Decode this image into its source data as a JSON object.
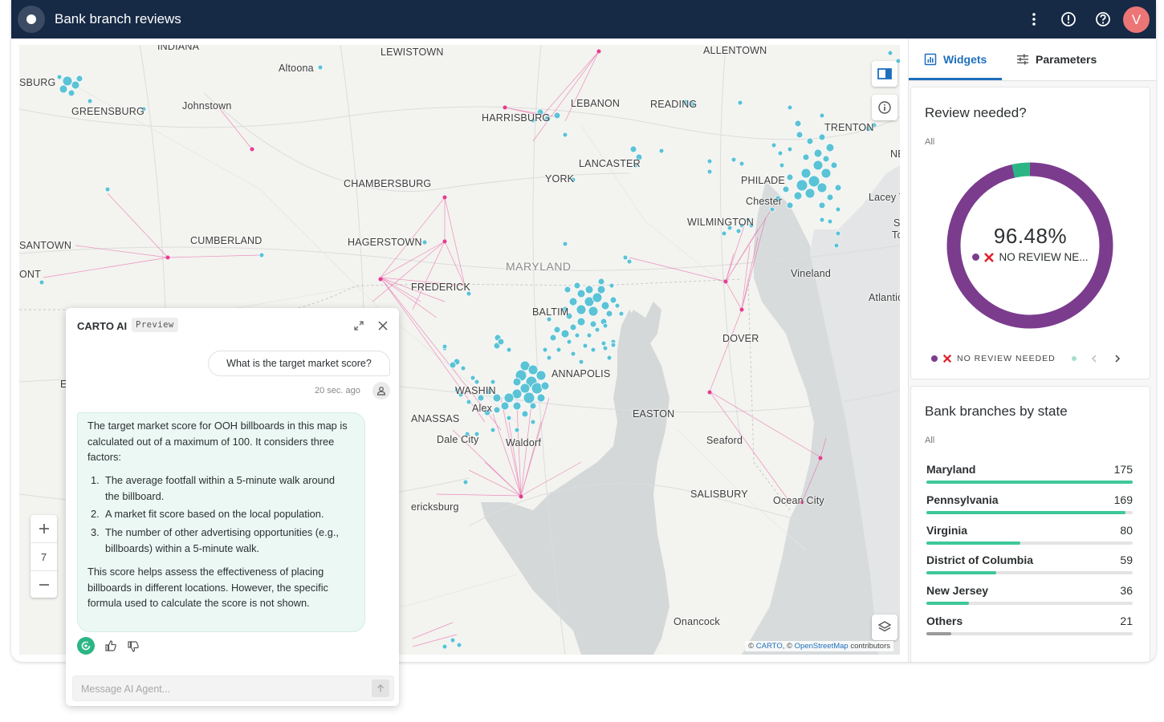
{
  "app": {
    "title": "Bank branch reviews",
    "avatar_letter": "V",
    "colors": {
      "topbar": "#162945",
      "accent": "#1f6fbd",
      "avatar": "#ec7575",
      "bar": "#3ec79a",
      "donut": "#7b3c8e",
      "donut_minor": "#2bb585"
    }
  },
  "map": {
    "labels": {
      "indiana": "INDIANA",
      "lewistown": "LEWISTOWN",
      "allentown": "ALLENTOWN",
      "altoona": "Altoona",
      "burg": "SBURG",
      "greensburg": "GREENSBURG",
      "johnstown": "Johnstown",
      "lebanon": "LEBANON",
      "reading": "READING",
      "harrisburg": "HARRISBURG",
      "trenton": "TRENTON",
      "new": "NEW",
      "lancaster": "LANCASTER",
      "york": "YORK",
      "chambersburg": "CHAMBERSBURG",
      "philadelphia": "PHILADE",
      "chester": "Chester",
      "lacey": "Lacey To",
      "s": "S",
      "to": "To",
      "wilmington": "WILMINGTON",
      "santown": "SANTOWN",
      "cumberland": "CUMBERLAND",
      "hagerstown": "HAGERSTOWN",
      "maryland": "MARYLAND",
      "ont": "ONT",
      "frederick": "FREDERICK",
      "vineland": "Vineland",
      "baltimore": "BALTIM",
      "atlantic": "Atlantic C",
      "dover": "DOVER",
      "elk": "ELK",
      "annapolis": "ANNAPOLIS",
      "washington": "WASHIN",
      "alexandria": "Alex",
      "manassas": "ANASSAS",
      "easton": "EASTON",
      "dale_city": "Dale City",
      "waldorf": "Waldorf",
      "seaford": "Seaford",
      "fredericksburg": "ericksburg",
      "salisbury": "SALISBURY",
      "ocean_city": "Ocean City",
      "onancock": "Onancock"
    },
    "zoom_level": "7",
    "attribution": {
      "carto": "CARTO",
      "osm": "OpenStreetMap",
      "prefix": "©",
      "sep": ", ©",
      "suffix": "contributors"
    },
    "icons": {
      "zoom_in": "plus-icon",
      "zoom_out": "minus-icon",
      "layers": "layers-icon",
      "info": "info-icon",
      "panel": "panel-toggle-icon"
    }
  },
  "panel": {
    "tabs": {
      "widgets": "Widgets",
      "parameters": "Parameters"
    },
    "review_widget": {
      "title": "Review needed?",
      "filter": "All",
      "percent": "96.48%",
      "percent_value": 96.48,
      "center_label": "NO REVIEW NE...",
      "legend": "NO REVIEW NEEDED"
    },
    "state_widget": {
      "title": "Bank branches by state",
      "filter": "All",
      "rows": [
        {
          "name": "Maryland",
          "value": 175
        },
        {
          "name": "Pennsylvania",
          "value": 169
        },
        {
          "name": "Virginia",
          "value": 80
        },
        {
          "name": "District of Columbia",
          "value": 59
        },
        {
          "name": "New Jersey",
          "value": 36
        },
        {
          "name": "Others",
          "value": 21
        }
      ]
    }
  },
  "chat": {
    "title": "CARTO AI",
    "badge": "Preview",
    "user_message": "What is the target market score?",
    "timestamp": "20 sec. ago",
    "answer": {
      "intro": "The target market score for OOH billboards in this map is calculated out of a maximum of 100. It considers three factors:",
      "items": [
        {
          "n": "1.",
          "text": "The average footfall within a 5-minute walk around the billboard."
        },
        {
          "n": "2.",
          "text": "A market fit score based on the local population."
        },
        {
          "n": "3.",
          "text": "The number of other advertising opportunities (e.g., billboards) within a 5-minute walk."
        }
      ],
      "outro": "This score helps assess the effectiveness of placing billboards in different locations. However, the specific formula used to calculate the score is not shown."
    },
    "input_placeholder": "Message AI Agent..."
  }
}
